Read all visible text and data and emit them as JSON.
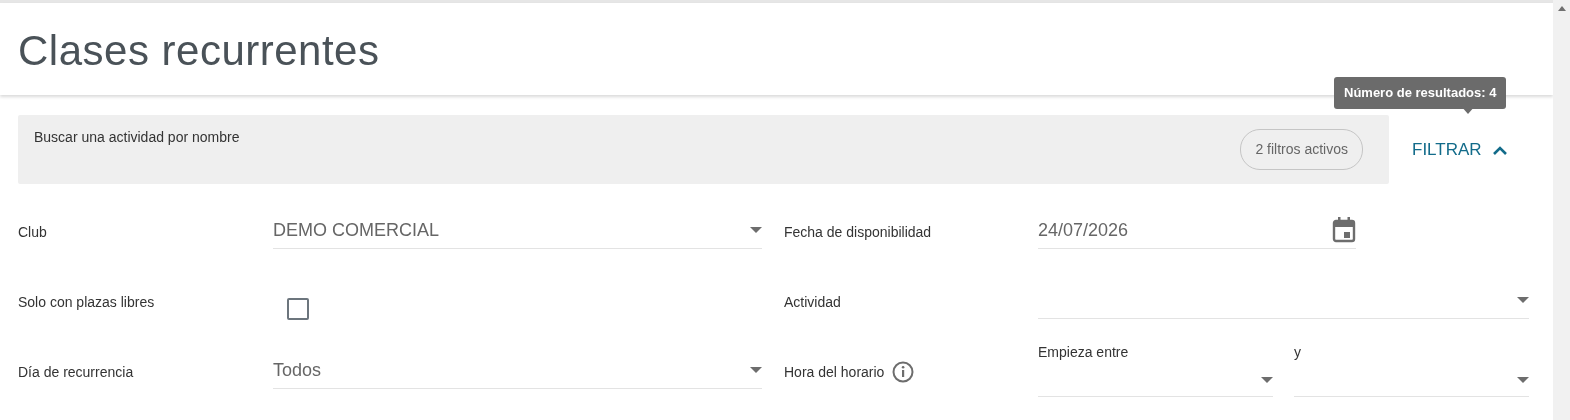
{
  "page": {
    "title": "Clases recurrentes"
  },
  "search": {
    "placeholder": "Buscar una actividad por nombre",
    "active_filters": "2 filtros activos"
  },
  "filter_button": {
    "label": "FILTRAR",
    "expanded": true
  },
  "tooltip": {
    "text": "Número de resultados: 4"
  },
  "filters_left": [
    {
      "kind": "select",
      "label": "Club",
      "value": "DEMO COMERCIAL"
    },
    {
      "kind": "checkbox",
      "label": "Solo con plazas libres",
      "checked": false
    },
    {
      "kind": "select",
      "label": "Día de recurrencia",
      "value": "Todos"
    }
  ],
  "filters_right": [
    {
      "kind": "date",
      "label": "Fecha de disponibilidad",
      "value": "24/07/2026"
    },
    {
      "kind": "select",
      "label": "Actividad"
    },
    {
      "kind": "range",
      "label": "Hora del horario",
      "info": true,
      "from_label": "Empieza entre",
      "to_label": "y"
    }
  ]
}
